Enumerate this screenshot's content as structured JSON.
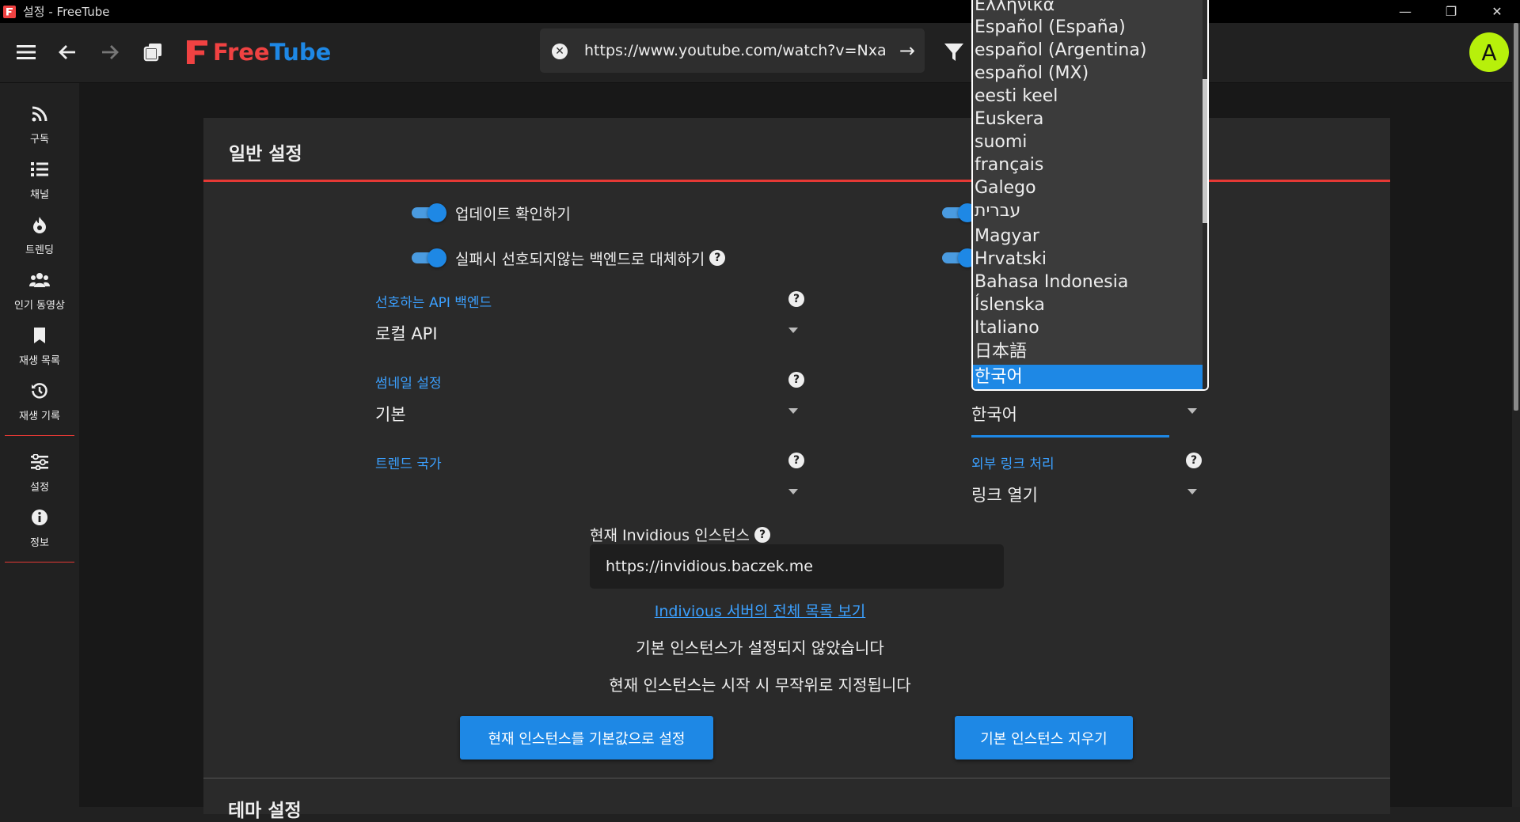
{
  "window": {
    "title": "설정 - FreeTube",
    "minimize_glyph": "—",
    "maximize_glyph": "❐",
    "close_glyph": "✕"
  },
  "header": {
    "logo_free": "Free",
    "logo_tube": "Tube",
    "search_value": "https://www.youtube.com/watch?v=NxaUG",
    "clear_glyph": "✕",
    "go_glyph": "→",
    "avatar_letter": "A"
  },
  "sidebar": {
    "items": [
      {
        "label": "구독",
        "icon": "rss-icon"
      },
      {
        "label": "채널",
        "icon": "list-icon"
      },
      {
        "label": "트렌딩",
        "icon": "fire-icon"
      },
      {
        "label": "인기 동영상",
        "icon": "users-icon"
      },
      {
        "label": "재생 목록",
        "icon": "bookmark-icon"
      },
      {
        "label": "재생 기록",
        "icon": "history-icon"
      },
      {
        "label": "설정",
        "icon": "sliders-icon"
      },
      {
        "label": "정보",
        "icon": "info-icon"
      }
    ]
  },
  "settings": {
    "section_title": "일반 설정",
    "toggles": [
      {
        "label": "업데이트 확인하기",
        "on": true
      },
      {
        "label": "실패시 선호되지않는 백엔드로 대체하기",
        "on": true
      }
    ],
    "help_glyph": "?",
    "fields": {
      "api_backend": {
        "label": "선호하는 API 백엔드",
        "value": "로컬 API"
      },
      "thumbnail": {
        "label": "썸네일 설정",
        "value": "기본"
      },
      "trend_country": {
        "label": "트렌드 국가",
        "value": ""
      },
      "locale": {
        "label": "",
        "value": "한국어"
      },
      "external_link": {
        "label": "외부 링크 처리",
        "value": "링크 열기"
      }
    },
    "invidious": {
      "label": "현재 Invidious 인스턴스",
      "value": "https://invidious.baczek.me",
      "link": "Indivious 서버의 전체 목록 보기",
      "line1": "기본 인스턴스가 설정되지 않았습니다",
      "line2": "현재 인스턴스는 시작 시 무작위로 지정됩니다",
      "btn_set_default": "현재 인스턴스를 기본값으로 설정",
      "btn_clear_default": "기본 인스턴스 지우기"
    },
    "next_section_title": "테마 설정"
  },
  "dropdown": {
    "options": [
      "Ελληνικά",
      "Español (España)",
      "español (Argentina)",
      "español (MX)",
      "eesti keel",
      "Euskera",
      "suomi",
      "français",
      "Galego",
      "עברית",
      "Magyar",
      "Hrvatski",
      "Bahasa Indonesia",
      "Íslenska",
      "Italiano",
      "日本語",
      "한국어"
    ],
    "selected": "한국어"
  },
  "colors": {
    "accent": "#1e88e5",
    "brand_red": "#f04242",
    "avatar": "#b7f00b"
  }
}
